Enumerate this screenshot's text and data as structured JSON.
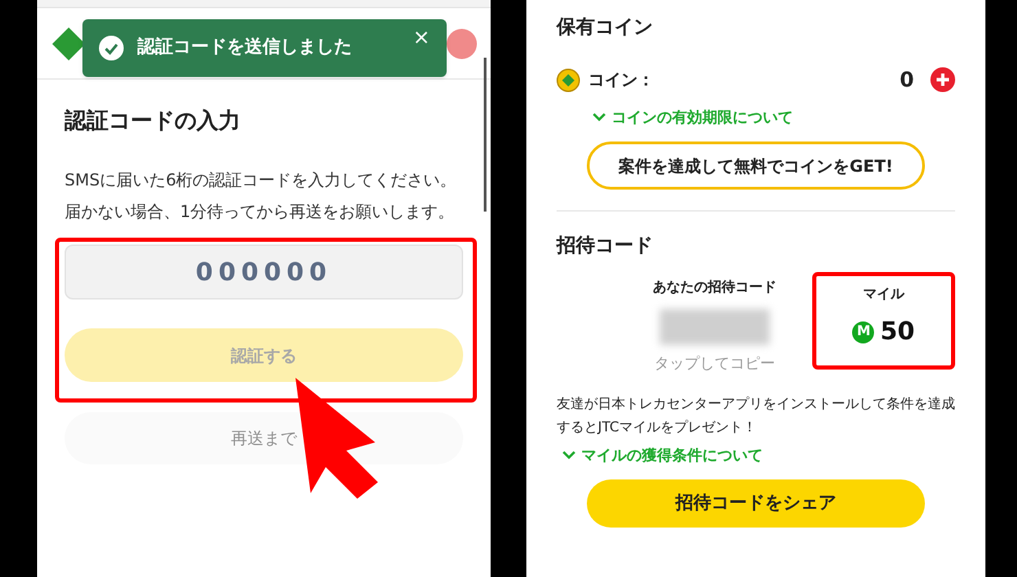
{
  "left_screen": {
    "toast": {
      "message": "認証コードを送信しました",
      "close": "×"
    },
    "title": "認証コードの入力",
    "description": "SMSに届いた6桁の認証コードを入力してください。届かない場合、1分待ってから再送をお願いします。",
    "code_field": {
      "placeholder": "000000"
    },
    "verify_button": {
      "label": "認証する",
      "disabled": true
    },
    "resend_button": {
      "label": "再送まで",
      "disabled": true
    }
  },
  "right_screen": {
    "coins": {
      "title": "保有コイン",
      "label": "コイン：",
      "amount": "0",
      "expiry_link": "コインの有効期限について",
      "earn_button": "案件を達成して無料でコインをGET!"
    },
    "invite": {
      "title": "招待コード",
      "code_label": "あなたの招待コード",
      "copy_hint": "タップしてコピー",
      "mile_label": "マイル",
      "mile_badge": "M",
      "mile_amount": "50",
      "description": "友達が日本トレカセンターアプリをインストールして条件を達成するとJTCマイルをプレゼント！",
      "conditions_link": "マイルの獲得条件について",
      "share_button": "招待コードをシェア"
    }
  }
}
